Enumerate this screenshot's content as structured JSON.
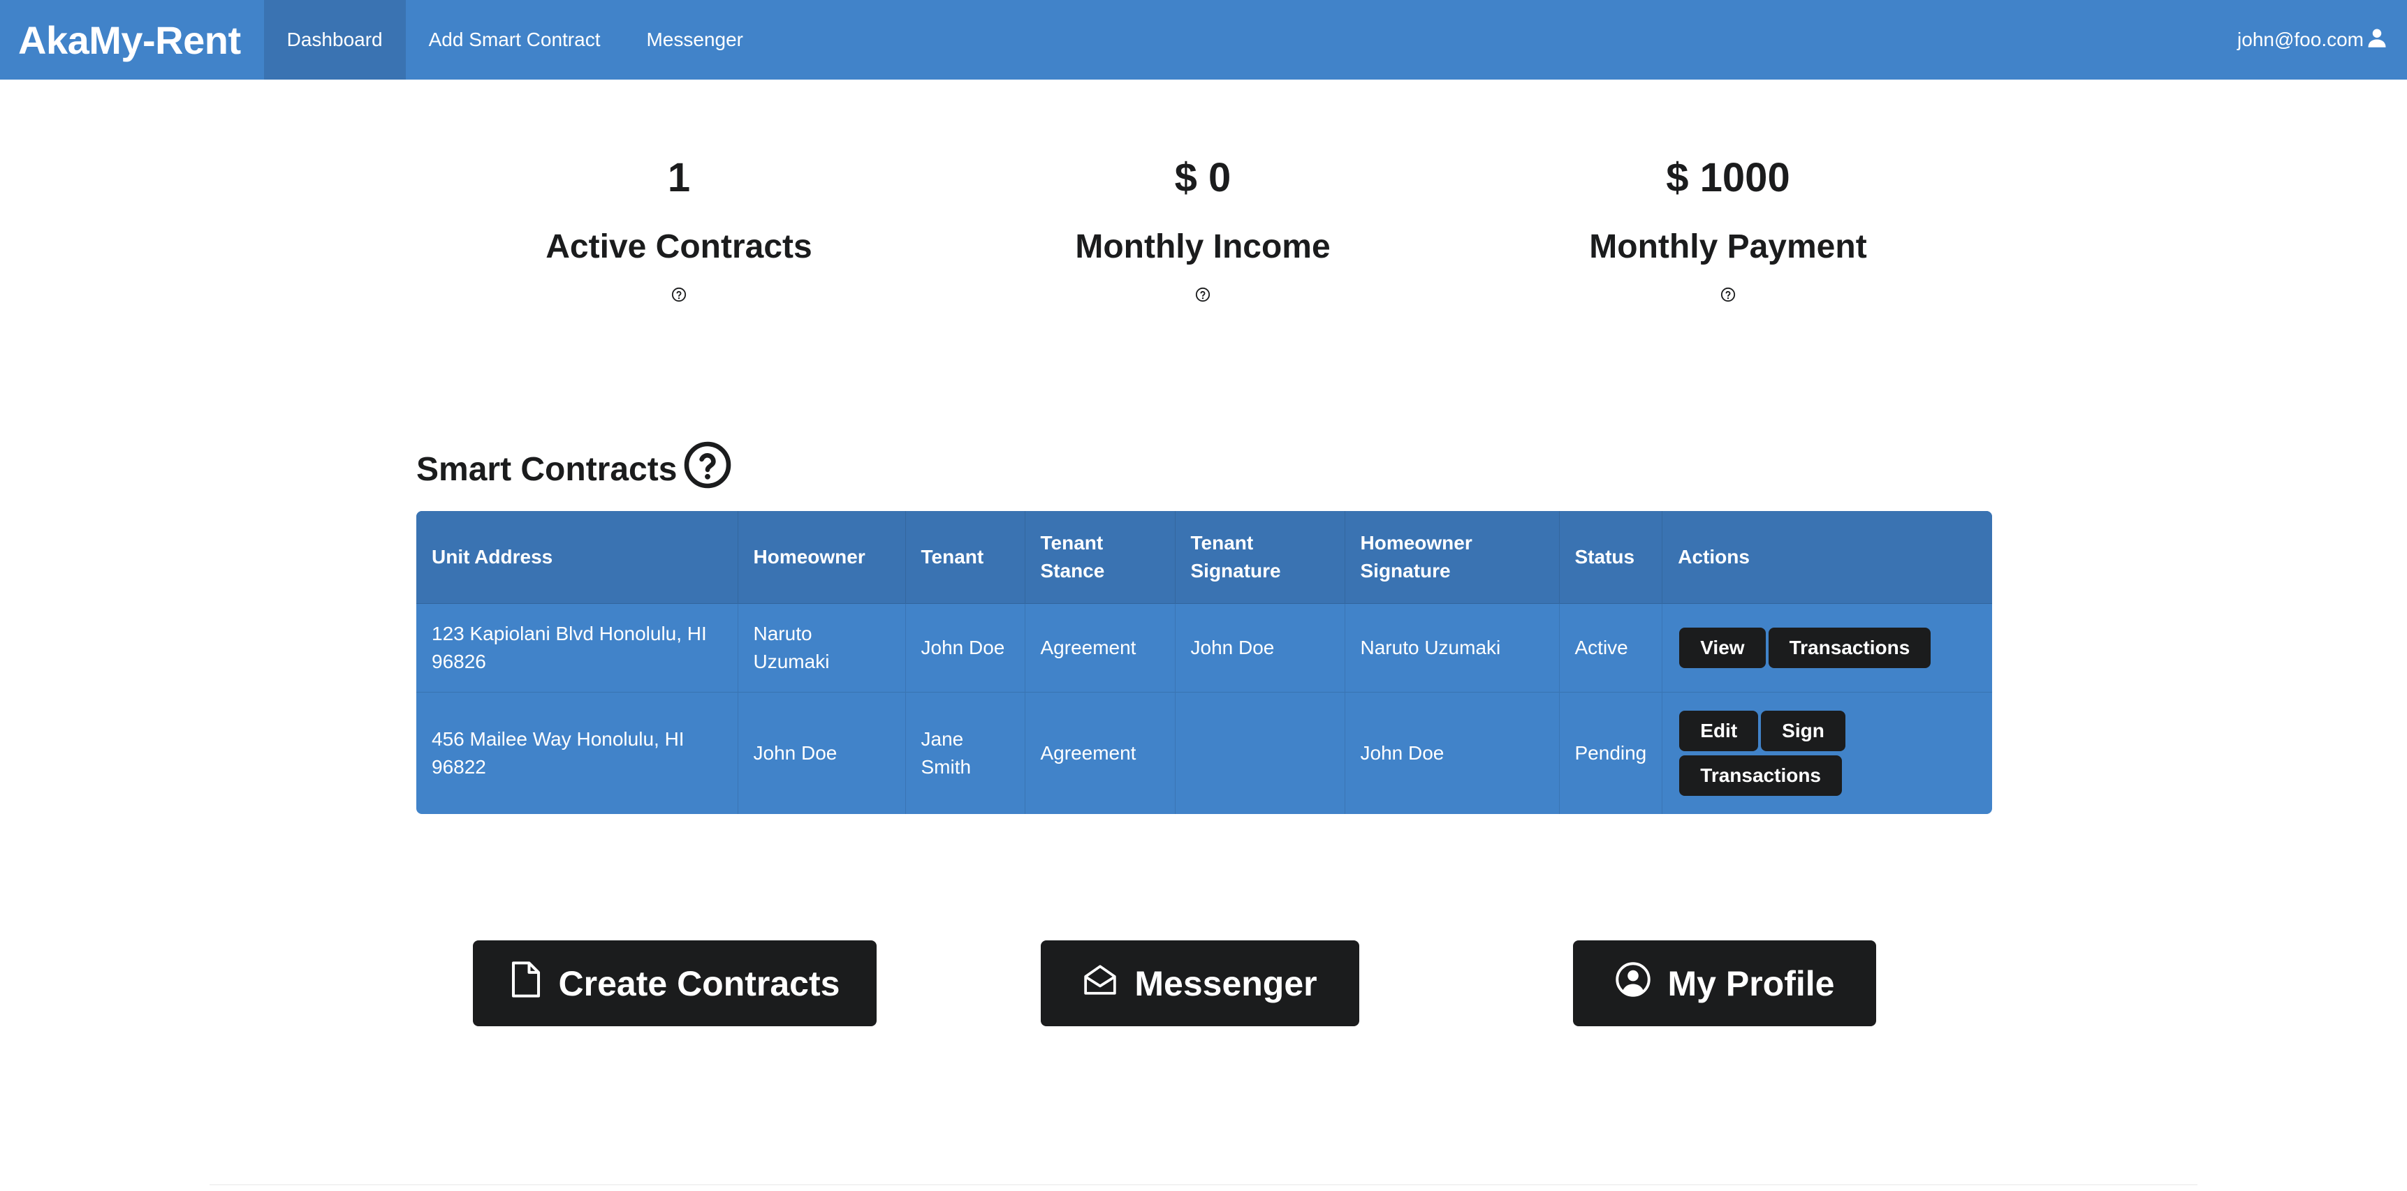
{
  "brand": "AkaMy-Rent",
  "nav": {
    "items": [
      {
        "label": "Dashboard",
        "active": true
      },
      {
        "label": "Add Smart Contract",
        "active": false
      },
      {
        "label": "Messenger",
        "active": false
      }
    ],
    "user_email": "john@foo.com",
    "user_icon": "user-icon"
  },
  "stats": [
    {
      "value": "1",
      "label": "Active Contracts",
      "icon": "question-circle-icon"
    },
    {
      "value": "$ 0",
      "label": "Monthly Income",
      "icon": "question-circle-icon"
    },
    {
      "value": "$ 1000",
      "label": "Monthly Payment",
      "icon": "question-circle-icon"
    }
  ],
  "smart_contracts": {
    "title": "Smart Contracts",
    "help_icon": "question-circle-icon",
    "columns": [
      "Unit Address",
      "Homeowner",
      "Tenant",
      "Tenant Stance",
      "Tenant Signature",
      "Homeowner Signature",
      "Status",
      "Actions"
    ],
    "rows": [
      {
        "unit_address": "123 Kapiolani Blvd Honolulu, HI 96826",
        "homeowner": "Naruto Uzumaki",
        "tenant": "John Doe",
        "tenant_stance": "Agreement",
        "tenant_signature": "John Doe",
        "homeowner_signature": "Naruto Uzumaki",
        "status": "Active",
        "actions": [
          "View",
          "Transactions"
        ]
      },
      {
        "unit_address": "456 Mailee Way Honolulu, HI 96822",
        "homeowner": "John Doe",
        "tenant": "Jane Smith",
        "tenant_stance": "Agreement",
        "tenant_signature": "",
        "homeowner_signature": "John Doe",
        "status": "Pending",
        "actions": [
          "Edit",
          "Sign",
          "Transactions"
        ]
      }
    ]
  },
  "quick_actions": [
    {
      "label": "Create Contracts",
      "icon": "file-icon"
    },
    {
      "label": "Messenger",
      "icon": "envelope-open-icon"
    },
    {
      "label": "My Profile",
      "icon": "user-circle-icon"
    }
  ],
  "colors": {
    "primary": "#4183c9",
    "primary_dark": "#3a73b2",
    "button_dark": "#1b1c1d",
    "text": "#1b1c1d"
  }
}
